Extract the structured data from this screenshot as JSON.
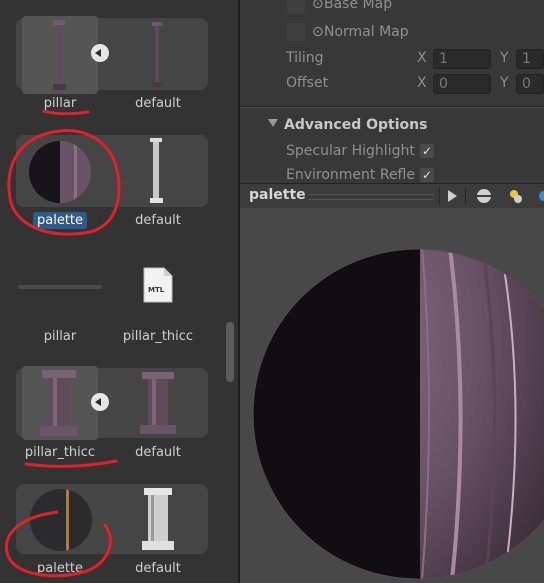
{
  "colors": {
    "annotation_red": "#e0212b",
    "selection_blue": "#2f5b8a",
    "material_dark": "#1a1519",
    "material_mauve": "#6e5568"
  },
  "assets": [
    {
      "label": "pillar",
      "kind": "model"
    },
    {
      "label": "default",
      "kind": "model"
    },
    {
      "label": "palette",
      "kind": "material",
      "selected": true
    },
    {
      "label": "default",
      "kind": "model"
    },
    {
      "label": "pillar",
      "kind": "model"
    },
    {
      "label": "pillar_thicc",
      "kind": "mtl-file",
      "icon_text": "MTL"
    },
    {
      "label": "pillar_thicc",
      "kind": "model"
    },
    {
      "label": "default",
      "kind": "model"
    },
    {
      "label": "palette",
      "kind": "material"
    },
    {
      "label": "default",
      "kind": "model"
    }
  ],
  "inspector": {
    "base_map": "Base Map",
    "normal_map": "Normal Map",
    "tiling": {
      "label": "Tiling",
      "x_label": "X",
      "x": "1",
      "y_label": "Y",
      "y": "1"
    },
    "offset": {
      "label": "Offset",
      "x_label": "X",
      "x": "0",
      "y_label": "Y",
      "y": "0"
    },
    "advanced_options": "Advanced Options",
    "specular_highlights": "Specular Highlight",
    "environment_reflections": "Environment Refle"
  },
  "preview": {
    "title": "palette"
  }
}
